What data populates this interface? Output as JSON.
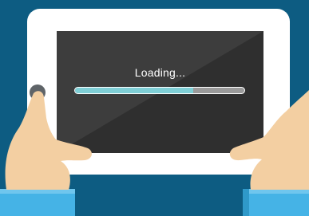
{
  "screen": {
    "loading_text": "Loading...",
    "progress_fraction": 0.7
  },
  "colors": {
    "background": "#0d5c82",
    "tablet_frame": "#ffffff",
    "screen": "#3d3d3d",
    "progress_fill": "#7fcfd6",
    "progress_track": "#9a9a9a",
    "skin": "#f3cfa2",
    "sleeve": "#45b3e6"
  },
  "icons": [
    "home-button-icon",
    "left-hand",
    "right-hand"
  ]
}
